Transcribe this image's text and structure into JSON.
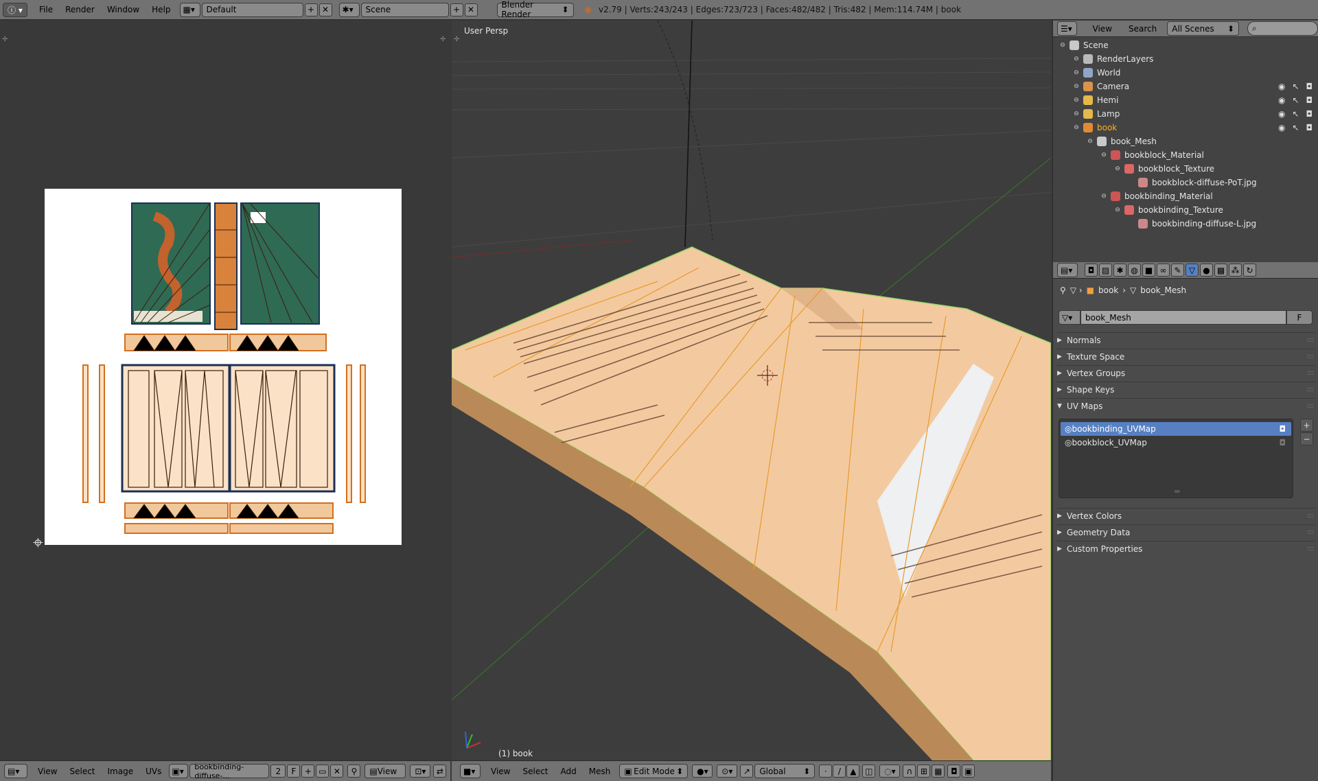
{
  "topbar": {
    "menus": [
      "File",
      "Render",
      "Window",
      "Help"
    ],
    "layout": "Default",
    "scene": "Scene",
    "engine": "Blender Render",
    "stats": "v2.79 | Verts:243/243 | Edges:723/723 | Faces:482/482 | Tris:482 | Mem:114.74M | book"
  },
  "viewport": {
    "view_name": "User Persp",
    "object_label": "(1) book",
    "header_menus": [
      "View",
      "Select",
      "Add",
      "Mesh"
    ],
    "mode": "Edit Mode",
    "orientation": "Global"
  },
  "uv_editor": {
    "header_menus": [
      "View",
      "Select",
      "Image",
      "UVs"
    ],
    "image_name": "bookbinding-diffuse-...",
    "users": "2",
    "fake_user": "F",
    "view_label": "View"
  },
  "outliner": {
    "menus": [
      "View",
      "Search"
    ],
    "display_mode": "All Scenes",
    "items": [
      {
        "label": "Scene",
        "depth": 0,
        "icon": "scene-icon"
      },
      {
        "label": "RenderLayers",
        "depth": 1,
        "icon": "render-layers-icon"
      },
      {
        "label": "World",
        "depth": 1,
        "icon": "world-icon"
      },
      {
        "label": "Camera",
        "depth": 1,
        "icon": "camera-icon"
      },
      {
        "label": "Hemi",
        "depth": 1,
        "icon": "lamp-icon"
      },
      {
        "label": "Lamp",
        "depth": 1,
        "icon": "lamp-icon"
      },
      {
        "label": "book",
        "depth": 1,
        "icon": "mesh-object-icon"
      },
      {
        "label": "book_Mesh",
        "depth": 2,
        "icon": "mesh-data-icon"
      },
      {
        "label": "bookblock_Material",
        "depth": 3,
        "icon": "material-icon"
      },
      {
        "label": "bookblock_Texture",
        "depth": 4,
        "icon": "texture-icon"
      },
      {
        "label": "bookblock-diffuse-PoT.jpg",
        "depth": 5,
        "icon": "image-icon"
      },
      {
        "label": "bookbinding_Material",
        "depth": 3,
        "icon": "material-icon"
      },
      {
        "label": "bookbinding_Texture",
        "depth": 4,
        "icon": "texture-icon"
      },
      {
        "label": "bookbinding-diffuse-L.jpg",
        "depth": 5,
        "icon": "image-icon"
      }
    ]
  },
  "properties": {
    "breadcrumb": [
      "book",
      "book_Mesh"
    ],
    "mesh_name": "book_Mesh",
    "fake_user": "F",
    "panels_top": [
      "Normals",
      "Texture Space",
      "Vertex Groups",
      "Shape Keys",
      "UV Maps"
    ],
    "uv_maps": [
      "bookbinding_UVMap",
      "bookblock_UVMap"
    ],
    "panels_bottom": [
      "Vertex Colors",
      "Geometry Data",
      "Custom Properties"
    ]
  },
  "colors": {
    "selected_outline": "#ffaf29",
    "active_item": "#5680c2",
    "header": "#727272",
    "viewport_bg": "#3d3d3d"
  }
}
